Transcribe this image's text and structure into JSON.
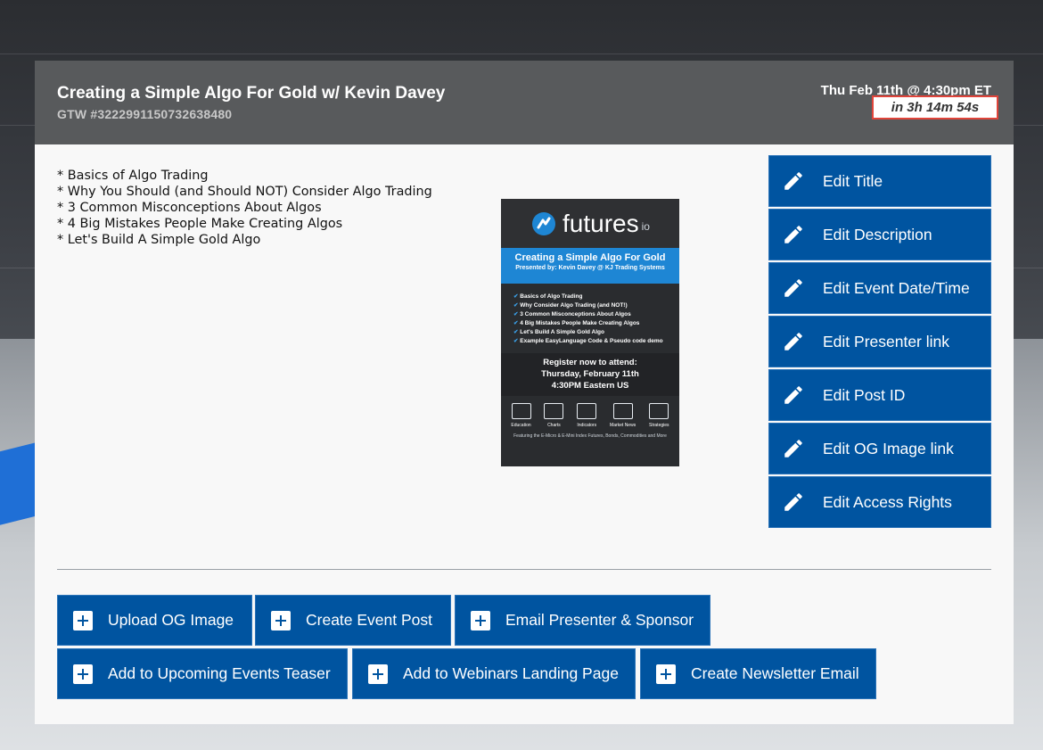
{
  "event": {
    "title": "Creating a Simple Algo For Gold w/ Kevin Davey",
    "gtw_id": "GTW #3222991150732638480",
    "datetime": "Thu Feb 11th @ 4:30pm ET",
    "countdown": "in 3h 14m 54s"
  },
  "description": [
    "* Basics of Algo Trading",
    "* Why You Should (and Should NOT) Consider Algo Trading",
    "* 3 Common Misconceptions About Algos",
    "* 4 Big Mistakes People Make Creating Algos",
    "* Let's Build A Simple Gold Algo"
  ],
  "poster": {
    "brand": "futures",
    "brand_suffix": "io",
    "headline": "Creating a Simple Algo For Gold",
    "presented_by": "Presented by: Kevin Davey @ KJ Trading Systems",
    "bullets": [
      "Basics of Algo Trading",
      "Why Consider Algo Trading (and NOT!)",
      "3 Common Misconceptions About Algos",
      "4 Big Mistakes People Make Creating Algos",
      "Let's Build A Simple Gold Algo",
      "Example EasyLanguage Code & Pseudo code demo"
    ],
    "register_line1": "Register now to attend:",
    "register_line2": "Thursday, February 11th",
    "register_line3": "4:30PM Eastern US",
    "icons": [
      {
        "label": "Education",
        "icon": "monitor-icon"
      },
      {
        "label": "Charts",
        "icon": "chart-icon"
      },
      {
        "label": "Indicators",
        "icon": "indicator-icon"
      },
      {
        "label": "Market News",
        "icon": "news-icon"
      },
      {
        "label": "Strategies",
        "icon": "flask-icon"
      }
    ],
    "footer": "Featuring the E-Micro & E-Mini Index Futures, Bonds, Commodities and More"
  },
  "edit_buttons": [
    {
      "label": "Edit Title",
      "icon": "pencil-icon"
    },
    {
      "label": "Edit Description",
      "icon": "pencil-icon"
    },
    {
      "label": "Edit Event Date/Time",
      "icon": "pencil-icon"
    },
    {
      "label": "Edit Presenter link",
      "icon": "pencil-icon"
    },
    {
      "label": "Edit Post ID",
      "icon": "pencil-icon"
    },
    {
      "label": "Edit OG Image link",
      "icon": "pencil-icon"
    },
    {
      "label": "Edit Access Rights",
      "icon": "pencil-icon"
    }
  ],
  "action_buttons": [
    {
      "label": "Upload OG Image",
      "icon": "plus-icon"
    },
    {
      "label": "Create Event Post",
      "icon": "plus-icon"
    },
    {
      "label": "Email Presenter & Sponsor",
      "icon": "plus-icon"
    },
    {
      "label": "Add to Upcoming Events Teaser",
      "icon": "plus-icon"
    },
    {
      "label": "Add to Webinars Landing Page",
      "icon": "plus-icon"
    },
    {
      "label": "Create Newsletter Email",
      "icon": "plus-icon"
    }
  ],
  "colors": {
    "button_blue": "#0054a0",
    "header_gray": "#585a5c",
    "countdown_border": "#e0443a",
    "poster_accent": "#1e86d4"
  }
}
